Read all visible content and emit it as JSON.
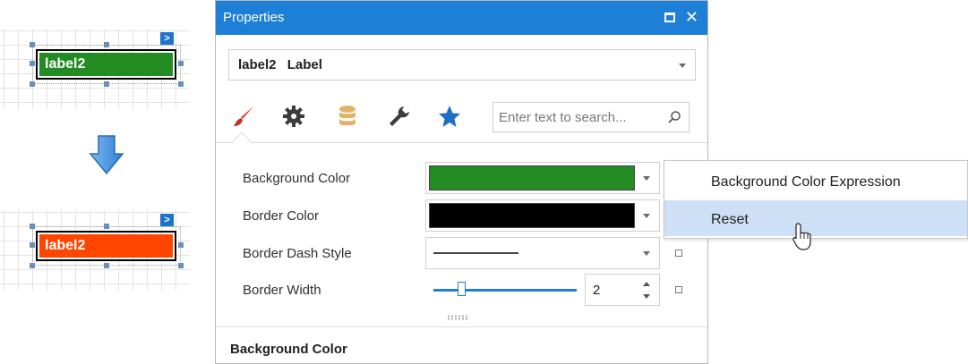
{
  "designer": {
    "before": {
      "label_text": "label2",
      "fill_color": "#228b22"
    },
    "after": {
      "label_text": "label2",
      "fill_color": "#ff4500"
    },
    "smart_tag": ">"
  },
  "panel": {
    "title": "Properties",
    "object_selector": {
      "name": "label2",
      "type": "Label"
    },
    "tabs": [
      "appearance-brush-icon",
      "behavior-gear-icon",
      "data-database-icon",
      "design-wrench-icon",
      "favorites-star-icon"
    ],
    "search": {
      "placeholder": "Enter text to search..."
    },
    "properties": [
      {
        "label": "Background Color",
        "value_color": "#228b22"
      },
      {
        "label": "Border Color",
        "value_color": "#000000"
      },
      {
        "label": "Border Dash Style",
        "value": "solid"
      },
      {
        "label": "Border Width",
        "value": "2",
        "slider_fraction": 0.2
      }
    ],
    "description_title": "Background Color"
  },
  "context_menu": {
    "items": [
      "Background Color Expression",
      "Reset"
    ],
    "highlighted_index": 1
  },
  "colors": {
    "accent": "#1e7fd6",
    "highlight": "#cde0f5"
  }
}
